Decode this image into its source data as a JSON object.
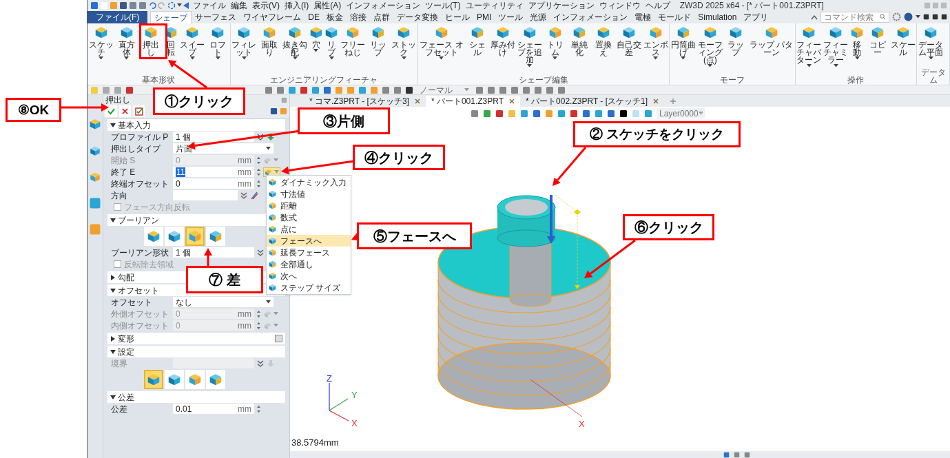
{
  "menu": [
    "ファイル",
    "編集",
    "表示(V)",
    "挿入(I)",
    "属性(A)",
    "インフォメーション",
    "ツール(T)",
    "ユーティリティ",
    "アプリケーション",
    "ウィンドウ",
    "ヘルプ"
  ],
  "window": {
    "title": "ZW3D 2025 x64 - [* パート001.Z3PRT]"
  },
  "ribbon": {
    "file_tab": "ファイル(F)",
    "tabs": [
      {
        "label": "シェープ",
        "selected": true
      },
      {
        "label": "サーフェス",
        "selected": false
      },
      {
        "label": "ワイヤフレーム",
        "selected": false
      },
      {
        "label": "DE",
        "selected": false
      },
      {
        "label": "板金",
        "selected": false
      },
      {
        "label": "溶接",
        "selected": false
      },
      {
        "label": "点群",
        "selected": false
      },
      {
        "label": "データ変換",
        "selected": false
      },
      {
        "label": "ヒール",
        "selected": false
      },
      {
        "label": "PMI",
        "selected": false
      },
      {
        "label": "ツール",
        "selected": false
      },
      {
        "label": "光源",
        "selected": false
      },
      {
        "label": "インフォメーション",
        "selected": false
      },
      {
        "label": "電極",
        "selected": false
      },
      {
        "label": "モールド",
        "selected": false
      },
      {
        "label": "Simulation",
        "selected": false
      },
      {
        "label": "アプリ",
        "selected": false
      }
    ],
    "search": {
      "placeholder": "コマンド検索"
    },
    "groups": [
      {
        "label": "基本形状",
        "buttons": [
          {
            "label": "スケッチ",
            "dropdown": true
          },
          {
            "label": "直方体",
            "dropdown": true
          },
          {
            "label": "押出し",
            "dropdown": false
          },
          {
            "label": "回転",
            "dropdown": false
          },
          {
            "label": "スイープ",
            "dropdown": true
          },
          {
            "label": "ロフト",
            "dropdown": true
          }
        ]
      },
      {
        "label": "エンジニアリングフィーチャ",
        "buttons": [
          {
            "label": "フィレット",
            "dropdown": true
          },
          {
            "label": "面取り",
            "dropdown": false
          },
          {
            "label": "抜き勾配",
            "dropdown": true
          },
          {
            "label": "穴",
            "dropdown": true
          },
          {
            "label": "リブ",
            "dropdown": true
          },
          {
            "label": "フリーねじ",
            "dropdown": false
          },
          {
            "label": "リップ",
            "dropdown": false
          },
          {
            "label": "ストック",
            "dropdown": true
          }
        ]
      },
      {
        "label": "シェープ編集",
        "buttons": [
          {
            "label": "フェース オフセット",
            "dropdown": true
          },
          {
            "label": "シェル",
            "dropdown": false
          },
          {
            "label": "厚み付け",
            "dropdown": false
          },
          {
            "label": "シェープを追加",
            "dropdown": true
          },
          {
            "label": "トリム",
            "dropdown": true
          },
          {
            "label": "単純化",
            "dropdown": false
          },
          {
            "label": "置換え",
            "dropdown": false
          },
          {
            "label": "自己交差",
            "dropdown": false
          },
          {
            "label": "エンボス",
            "dropdown": true
          }
        ]
      },
      {
        "label": "モーフ",
        "buttons": [
          {
            "label": "円筒曲げ",
            "dropdown": true
          },
          {
            "label": "モーフィング(点)",
            "dropdown": true
          },
          {
            "label": "ラップ",
            "dropdown": false
          },
          {
            "label": "ラップ パターン",
            "dropdown": false
          }
        ]
      },
      {
        "label": "操作",
        "buttons": [
          {
            "label": "フィーチャパターン",
            "dropdown": true
          },
          {
            "label": "フィーチャミラー",
            "dropdown": true
          },
          {
            "label": "移動",
            "dropdown": true
          },
          {
            "label": "コピー",
            "dropdown": false
          },
          {
            "label": "スケール",
            "dropdown": false
          }
        ]
      },
      {
        "label": "データム",
        "buttons": [
          {
            "label": "データム平面",
            "dropdown": true
          }
        ]
      }
    ]
  },
  "toolbar": {
    "view_mode": "ノーマル"
  },
  "panel": {
    "title": "押出し",
    "sections": [
      {
        "title": "基本入力",
        "expanded": true,
        "rows": [
          {
            "kind": "pick",
            "label": "プロファイル P",
            "value": "1 個",
            "disabled": false,
            "picker": true
          },
          {
            "kind": "select",
            "label": "押出しタイプ",
            "value": "片面"
          },
          {
            "kind": "number",
            "label": "開始 S",
            "value": "0",
            "unit": "mm",
            "disabled": true,
            "highlighted": false,
            "picker": true,
            "expanded": false
          },
          {
            "kind": "number",
            "label": "終了 E",
            "value": "11",
            "unit": "mm",
            "disabled": false,
            "highlighted": true,
            "picker": true,
            "expanded": true
          },
          {
            "kind": "number",
            "label": "終端オフセット",
            "value": "0",
            "unit": "mm",
            "disabled": false,
            "highlighted": false,
            "picker": false
          },
          {
            "kind": "direction",
            "label": "方向"
          },
          {
            "kind": "checkbox",
            "label": "フェース方向反転",
            "checked": false,
            "disabled": true
          }
        ]
      },
      {
        "title": "ブーリアン",
        "expanded": true,
        "rows": [
          {
            "kind": "icons",
            "options": [
              {
                "selected": false
              },
              {
                "selected": false
              },
              {
                "selected": true
              },
              {
                "selected": false
              }
            ]
          },
          {
            "kind": "pick",
            "label": "ブーリアン形状",
            "value": "1 個",
            "disabled": false
          },
          {
            "kind": "checkbox",
            "label": "反転除去領域",
            "checked": false,
            "disabled": true
          }
        ]
      },
      {
        "title": "勾配",
        "expanded": false
      },
      {
        "title": "オフセット",
        "expanded": true,
        "rows": [
          {
            "kind": "select",
            "label": "オフセット",
            "value": "なし"
          },
          {
            "kind": "number",
            "label": "外側オフセット",
            "value": "0",
            "unit": "mm",
            "disabled": true,
            "highlighted": false,
            "picker": true,
            "expanded": false
          },
          {
            "kind": "number",
            "label": "内側オフセット",
            "value": "0",
            "unit": "mm",
            "disabled": true,
            "highlighted": false,
            "picker": true,
            "expanded": false
          }
        ]
      },
      {
        "title": "変形",
        "expanded": false,
        "toggle": {
          "checked": false
        }
      },
      {
        "title": "設定",
        "expanded": true,
        "rows": [
          {
            "kind": "pick",
            "label": "境界",
            "disabled": true,
            "picker": true
          },
          {
            "kind": "icons",
            "options": [
              {
                "selected": true
              },
              {
                "selected": false
              },
              {
                "selected": false
              },
              {
                "selected": false
              }
            ]
          }
        ]
      },
      {
        "title": "公差",
        "expanded": true,
        "rows": [
          {
            "kind": "number",
            "label": "公差",
            "value": "0.01",
            "unit": "mm",
            "disabled": false,
            "highlighted": false,
            "picker": false
          }
        ]
      }
    ]
  },
  "menu_popup": {
    "items": [
      {
        "label": "ダイナミック入力",
        "selected": false
      },
      {
        "label": "寸法値",
        "selected": false
      },
      {
        "label": "距離",
        "selected": false
      },
      {
        "label": "数式",
        "selected": false
      },
      {
        "label": "点に",
        "selected": false
      },
      {
        "label": "フェースへ",
        "selected": true
      },
      {
        "label": "延長フェース",
        "selected": false
      },
      {
        "label": "全部通し",
        "selected": false
      },
      {
        "label": "次へ",
        "selected": false
      },
      {
        "label": "ステップ サイズ",
        "selected": false
      }
    ]
  },
  "documents": {
    "tabs": [
      {
        "label": "* コマ.Z3PRT - [スケッチ3]",
        "selected": false
      },
      {
        "label": "* パート001.Z3PRT",
        "selected": true
      },
      {
        "label": "* パート002.Z3PRT - [スケッチ1]",
        "selected": false
      }
    ]
  },
  "view_toolbar": {
    "layer": "Layer0000"
  },
  "viewport": {
    "measure": "38.5794mm",
    "triad": {
      "x": "X",
      "y": "Y",
      "z": "Z"
    },
    "part_axis": "X"
  },
  "callouts": [
    {
      "label": "①クリック"
    },
    {
      "label": "② スケッチをクリック"
    },
    {
      "label": "③片側"
    },
    {
      "label": "④クリック"
    },
    {
      "label": "⑤フェースへ"
    },
    {
      "label": "⑥クリック"
    },
    {
      "label": "⑦ 差"
    },
    {
      "label": "⑧OK"
    }
  ]
}
